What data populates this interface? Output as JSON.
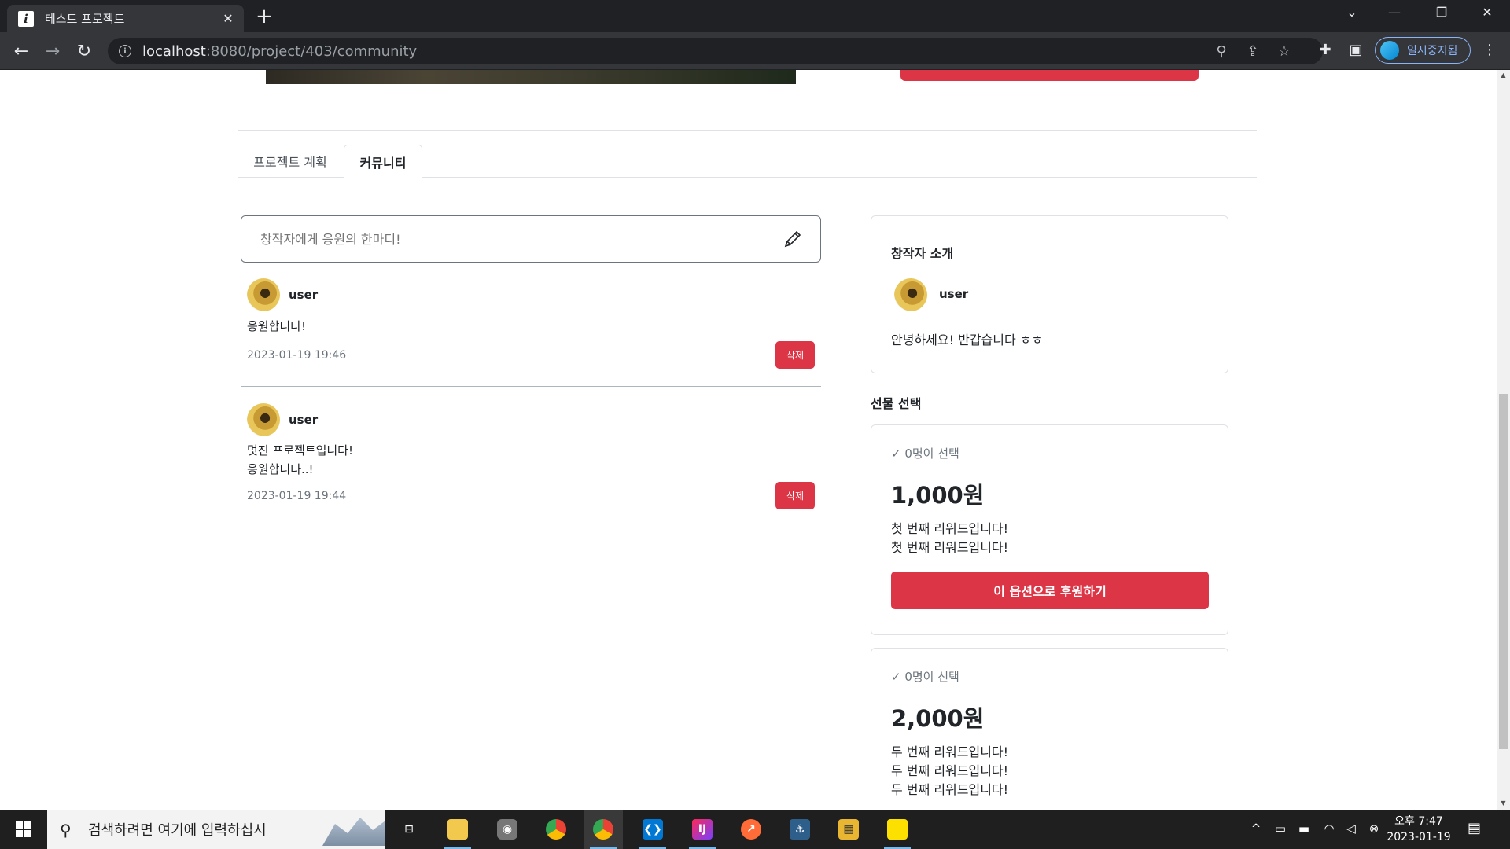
{
  "browser": {
    "tab_title": "테스트 프로젝트",
    "tab_close": "✕",
    "new_tab": "+",
    "url_host": "localhost",
    "url_path": ":8080/project/403/community",
    "profile_label": "일시중지됨",
    "icons": [
      "back-icon",
      "forward-icon",
      "reload-icon",
      "info-icon",
      "zoom-icon",
      "share-icon",
      "star-icon",
      "extensions-icon",
      "sidepanel-icon",
      "menu-icon"
    ]
  },
  "tabs": {
    "plan": "프로젝트 계획",
    "community": "커뮤니티",
    "active": "community"
  },
  "comment_input": {
    "placeholder": "창작자에게 응원의 한마디!"
  },
  "comments": [
    {
      "user": "user",
      "text": "응원합니다!",
      "date": "2023-01-19 19:46",
      "delete_label": "삭제"
    },
    {
      "user": "user",
      "text": "멋진 프로젝트입니다!\n응원합니다..!",
      "date": "2023-01-19 19:44",
      "delete_label": "삭제"
    }
  ],
  "creator": {
    "title": "창작자 소개",
    "name": "user",
    "bio": "안녕하세요! 반갑습니다 ㅎㅎ"
  },
  "gifts": {
    "heading": "선물 선택",
    "items": [
      {
        "selected": "✓ 0명이 선택",
        "price": "1,000원",
        "desc": "첫 번째 리워드입니다!\n첫 번째 리워드입니다!",
        "button": "이 옵션으로 후원하기"
      },
      {
        "selected": "✓ 0명이 선택",
        "price": "2,000원",
        "desc": "두 번째 리워드입니다!\n두 번째 리워드입니다!\n두 번째 리워드입니다!"
      }
    ]
  },
  "taskbar": {
    "search_placeholder": "검색하려면 여기에 입력하십시",
    "clock_time": "오후 7:47",
    "clock_date": "2023-01-19"
  },
  "colors": {
    "accent_red": "#dc3545",
    "chrome_dark": "#202124",
    "chrome_toolbar": "#35363a"
  }
}
